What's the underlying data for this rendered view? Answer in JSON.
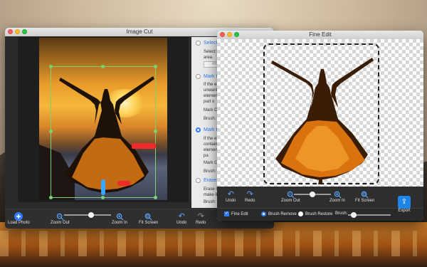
{
  "image_cut": {
    "title": "Image Cut",
    "side_panel": {
      "items": [
        {
          "heading": "Select el",
          "text": "Select the area.",
          "field_value": "400"
        },
        {
          "heading": "Mark the",
          "text": "If the exp unwanted element an the part o",
          "color_label": "Mark Colo",
          "brush_label": "Brush:"
        },
        {
          "heading": "Mark the",
          "text": "If the exp contain so as elemen but the pa",
          "color_label": "Mark Colo",
          "brush_label": "Brush:"
        },
        {
          "heading": "Erase the",
          "text": "Erase som make it m",
          "color_label": "Brush:"
        }
      ]
    },
    "toolbar": {
      "load_photo": "Load Photo",
      "zoom_out": "Zoom Out",
      "zoom_in": "Zoom In",
      "fit_screen": "Fit Screen",
      "undo": "Undo",
      "redo": "Redo"
    },
    "zoom_level": 0.58
  },
  "fine_edit": {
    "title": "Fine Edit",
    "toolbar": {
      "undo": "Undo",
      "redo": "Redo",
      "zoom_out": "Zoom Out",
      "zoom_in": "Zoom In",
      "fit_screen": "Fit Screen",
      "export": "Export"
    },
    "zoom_level": 0.5,
    "options": {
      "fine_edit": "Fine Edit",
      "brush_remove": "Brush Remove",
      "brush_restore": "Brush Restore",
      "brush_label": "Brush:"
    },
    "brush_level": 0.08
  },
  "colors": {
    "accent": "#2f7cf6",
    "selection": "#7bd36f",
    "mark_red": "#ee2b2b",
    "mark_blue": "#3aa7ff"
  }
}
